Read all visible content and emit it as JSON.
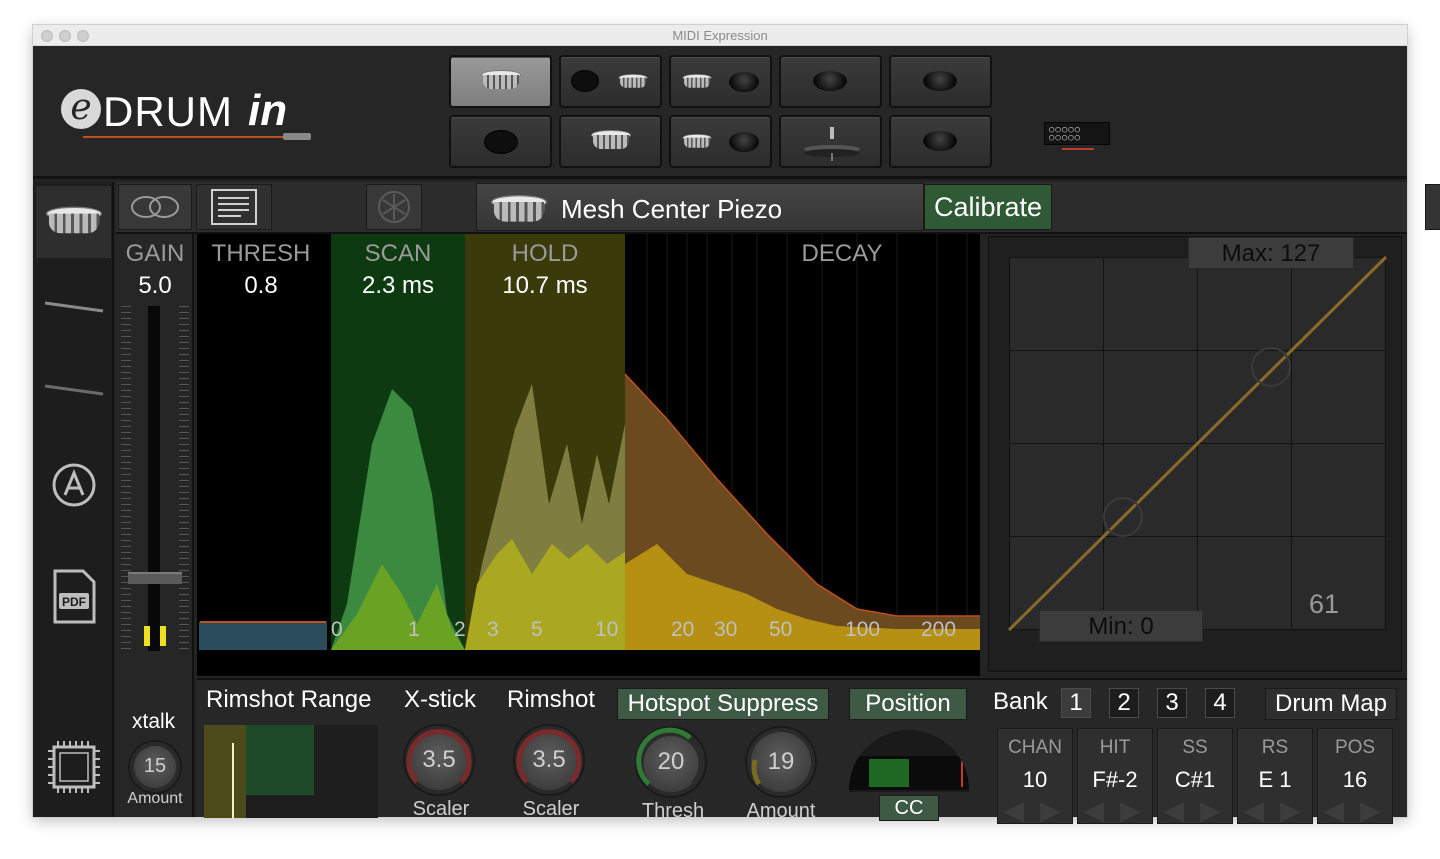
{
  "window": {
    "title": "MIDI Expression"
  },
  "logo": {
    "e": "e",
    "drum": "DRUM",
    "in": "in"
  },
  "pad_selector": {
    "pads": [
      {
        "icon": "snare-drum-icon",
        "selected": true
      },
      {
        "icon": "snare-pair-icon",
        "selected": false
      },
      {
        "icon": "tom-cymbal-pair-icon",
        "selected": false
      },
      {
        "icon": "cymbal-icon",
        "selected": false
      },
      {
        "icon": "cymbal-icon",
        "selected": false
      },
      {
        "icon": "black-pad-icon",
        "selected": false
      },
      {
        "icon": "snare-drum-icon",
        "selected": false
      },
      {
        "icon": "tom-cymbal-pair-icon",
        "selected": false
      },
      {
        "icon": "hihat-icon",
        "selected": false
      },
      {
        "icon": "cymbal-icon",
        "selected": false
      }
    ]
  },
  "toolbar": {
    "pad_name": "Mesh Center Piezo",
    "calibrate_label": "Calibrate"
  },
  "gain": {
    "label": "GAIN",
    "value": "5.0"
  },
  "graph": {
    "thresh": {
      "label": "THRESH",
      "value": "0.8"
    },
    "scan": {
      "label": "SCAN",
      "value": "2.3 ms"
    },
    "hold": {
      "label": "HOLD",
      "value": "10.7 ms"
    },
    "decay": {
      "label": "DECAY"
    },
    "ticks": [
      "0",
      "1",
      "2",
      "3",
      "5",
      "10",
      "20",
      "30",
      "50",
      "100",
      "200"
    ]
  },
  "curve": {
    "max_label": "Max: 127",
    "min_label": "Min: 0",
    "value": "61"
  },
  "xtalk": {
    "label": "xtalk",
    "value": "15",
    "sublabel": "Amount"
  },
  "bottom": {
    "rimshot_range_label": "Rimshot Range",
    "xstick": {
      "label": "X-stick",
      "value": "3.5",
      "sublabel": "Scaler"
    },
    "rimshot": {
      "label": "Rimshot",
      "value": "3.5",
      "sublabel": "Scaler"
    },
    "hotspot_label": "Hotspot Suppress",
    "hotspot_thresh": {
      "value": "20",
      "sublabel": "Thresh"
    },
    "hotspot_amount": {
      "value": "19",
      "sublabel": "Amount"
    },
    "position_label": "Position",
    "position_cc": "CC",
    "bank": {
      "label": "Bank",
      "options": [
        "1",
        "2",
        "3",
        "4"
      ],
      "selected": "1"
    },
    "drum_map_label": "Drum Map",
    "midi": [
      {
        "header": "CHAN",
        "value": "10"
      },
      {
        "header": "HIT",
        "value": "F#-2"
      },
      {
        "header": "SS",
        "value": "C#1"
      },
      {
        "header": "RS",
        "value": "E 1"
      },
      {
        "header": "POS",
        "value": "16"
      }
    ]
  },
  "colors": {
    "accent_green": "#2f5a35",
    "scan_zone": "#0f3a12",
    "hold_zone": "#3a3a0c",
    "decay_curve": "#c0501f"
  }
}
